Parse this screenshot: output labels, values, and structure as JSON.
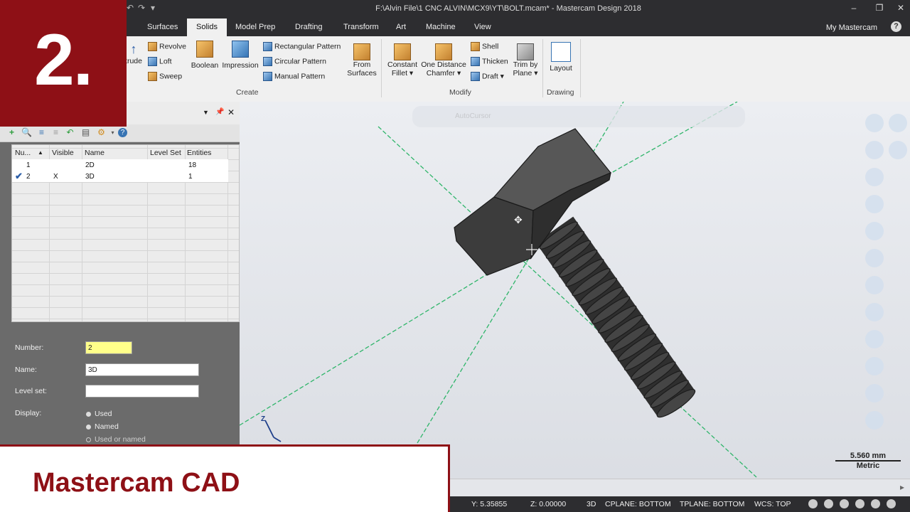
{
  "window": {
    "title": "F:\\Alvin File\\1 CNC ALVIN\\MCX9\\YT\\BOLT.mcam* - Mastercam Design 2018",
    "controls": [
      "minimize-icon",
      "restore-icon",
      "close-icon"
    ],
    "my_mastercam": "My Mastercam"
  },
  "tabs": [
    {
      "label": "Surfaces",
      "active": false
    },
    {
      "label": "Solids",
      "active": true
    },
    {
      "label": "Model Prep",
      "active": false
    },
    {
      "label": "Drafting",
      "active": false
    },
    {
      "label": "Transform",
      "active": false
    },
    {
      "label": "Art",
      "active": false
    },
    {
      "label": "Machine",
      "active": false
    },
    {
      "label": "View",
      "active": false
    }
  ],
  "ribbon": {
    "extrude_partial": "trude",
    "revolve": "Revolve",
    "loft": "Loft",
    "sweep": "Sweep",
    "boolean": "Boolean",
    "impression": "Impression",
    "rect_pattern": "Rectangular Pattern",
    "circ_pattern": "Circular Pattern",
    "manual_pattern": "Manual Pattern",
    "from_surfaces": [
      "From",
      "Surfaces"
    ],
    "constant_fillet": [
      "Constant",
      "Fillet ▾"
    ],
    "one_distance_chamfer": [
      "One Distance",
      "Chamfer ▾"
    ],
    "shell": "Shell",
    "thicken": "Thicken",
    "draft": "Draft ▾",
    "trim_by_plane": [
      "Trim by",
      "Plane ▾"
    ],
    "layout": "Layout",
    "groups": {
      "create": "Create",
      "modify": "Modify",
      "drawing": "Drawing"
    }
  },
  "levels": {
    "columns": [
      "Nu...",
      "Visible",
      "Name",
      "Level Set",
      "Entities"
    ],
    "rows": [
      {
        "active": false,
        "number": "1",
        "visible": "",
        "name": "2D",
        "level_set": "",
        "entities": "18"
      },
      {
        "active": true,
        "number": "2",
        "visible": "X",
        "name": "3D",
        "level_set": "",
        "entities": "1"
      }
    ],
    "form": {
      "number_label": "Number:",
      "number_value": "2",
      "name_label": "Name:",
      "name_value": "3D",
      "level_set_label": "Level set:",
      "level_set_value": "",
      "display_label": "Display:",
      "display_options": [
        "Used",
        "Named",
        "Used or named"
      ]
    }
  },
  "viewport": {
    "autocursor": "AutoCursor",
    "axis_label": "Z",
    "scale_value": "5.560 mm",
    "scale_unit": "Metric"
  },
  "status": {
    "y": "Y:  5.35855",
    "z": "Z:  0.00000",
    "mode": "3D",
    "cplane": "CPLANE: BOTTOM",
    "tplane": "TPLANE: BOTTOM",
    "wcs": "WCS: TOP"
  },
  "overlay": {
    "episode": "2.",
    "caption": "Mastercam CAD",
    "accent_color": "#8e1016"
  }
}
